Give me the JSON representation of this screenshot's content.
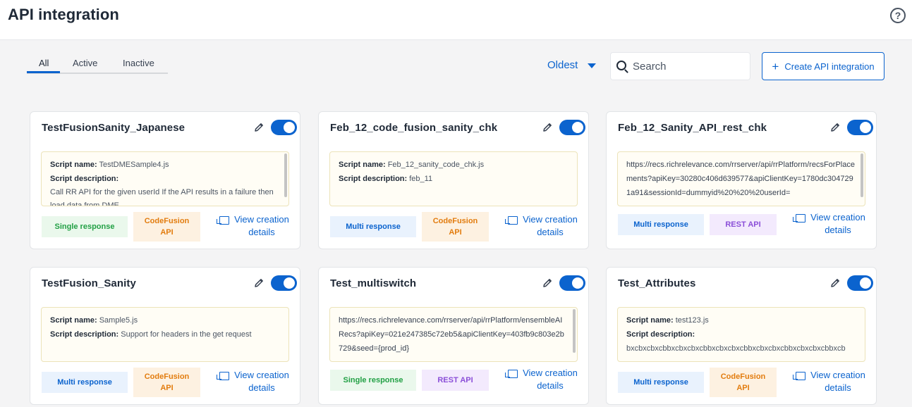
{
  "page": {
    "title": "API integration",
    "help_icon": "help-icon"
  },
  "tabs": [
    {
      "label": "All",
      "active": true
    },
    {
      "label": "Active",
      "active": false
    },
    {
      "label": "Inactive",
      "active": false
    }
  ],
  "sort": {
    "label": "Oldest"
  },
  "search": {
    "placeholder": "Search",
    "value": ""
  },
  "create_button": {
    "label": "Create API integration"
  },
  "labels": {
    "script_name": "Script name:",
    "script_description": "Script description:",
    "view_details": "View creation details"
  },
  "colors": {
    "accent": "#0b63ce",
    "single_response": "#22a045",
    "codefusion": "#e27c0e",
    "rest_api": "#8b4fd8"
  },
  "cards": [
    {
      "title": "TestFusionSanity_Japanese",
      "enabled": true,
      "script_name": "TestDMESample4.js",
      "script_description": "Call RR API for the given userId If the API results in a failure then load data from DME",
      "response_badge": "Single response",
      "api_badge": "CodeFusion API"
    },
    {
      "title": "Feb_12_code_fusion_sanity_chk",
      "enabled": true,
      "script_name": "Feb_12_sanity_code_chk.js",
      "script_description": "feb_11",
      "response_badge": "Multi response",
      "api_badge": "CodeFusion API"
    },
    {
      "title": "Feb_12_Sanity_API_rest_chk",
      "enabled": true,
      "url": "https://recs.richrelevance.com/rrserver/api/rrPlatform/recsForPlacements?apiKey=30280c406d639577&apiClientKey=1780dc3047291a91&sessionId=dummyid%20%20%20userId=",
      "response_badge": "Multi response",
      "api_badge": "REST API"
    },
    {
      "title": "TestFusion_Sanity",
      "enabled": true,
      "script_name": "Sample5.js",
      "script_description": "Support for headers in the get request",
      "response_badge": "Multi response",
      "api_badge": "CodeFusion API"
    },
    {
      "title": "Test_multiswitch",
      "enabled": true,
      "url": "https://recs.richrelevance.com/rrserver/api/rrPlatform/ensembleAIRecs?apiKey=021e247385c72eb5&apiClientKey=403fb9c803e2b729&seed={prod_id}",
      "response_badge": "Single response",
      "api_badge": "REST API"
    },
    {
      "title": "Test_Attributes",
      "enabled": true,
      "script_name": "test123.js",
      "script_description": "bxcbxcbxcbbxcbxcbxcbbxcbxcbxcbbxcbxcbxcbbxcbxcbxcbbxcb",
      "response_badge": "Multi response",
      "api_badge": "CodeFusion API"
    }
  ]
}
